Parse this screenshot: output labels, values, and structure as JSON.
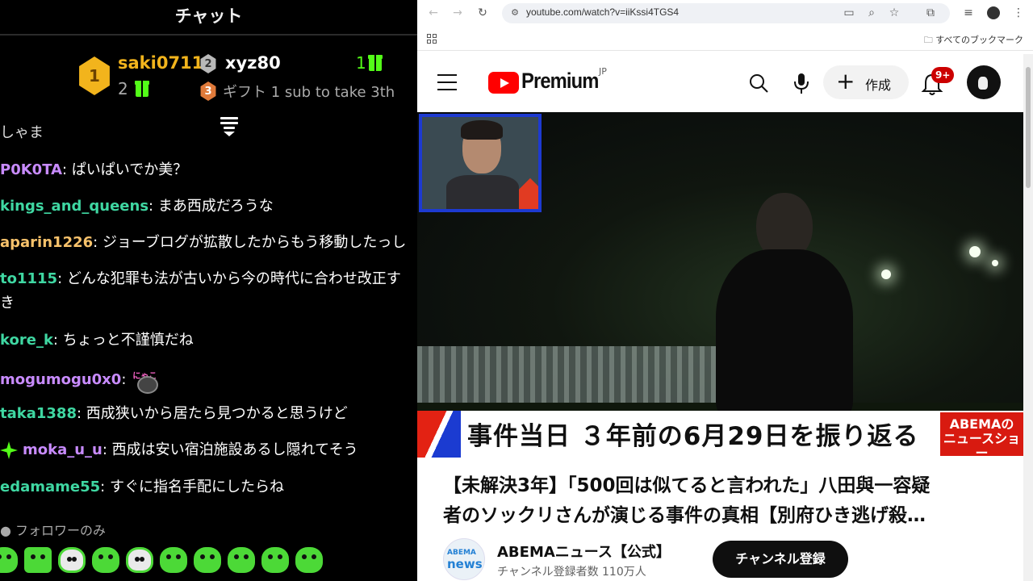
{
  "chat": {
    "title": "チャット",
    "leaderboard": {
      "first": {
        "rank": "1",
        "name": "saki0711",
        "count": "2"
      },
      "second": {
        "rank": "2",
        "name": "xyz80",
        "count": "1"
      },
      "third": {
        "rank": "3",
        "text": "ギフト 1 sub to take 3th"
      }
    },
    "cut_message": "しゃま",
    "messages": [
      {
        "user": "P0K0TA",
        "color": "#c88bff",
        "text": "ぱいぱいでか美？"
      },
      {
        "user": "kings_and_queens",
        "color": "#3fd7a2",
        "text": "まあ西成だろうな"
      },
      {
        "user": "aparin1226",
        "color": "#f7c26b",
        "text": "ジョーブログが拡散したからもう移動したっし"
      },
      {
        "user": "to1115",
        "color": "#3fd7a2",
        "text": "どんな犯罪も法が古いから今の時代に合わせ改正す",
        "text2": "き"
      },
      {
        "user": "kore_k",
        "color": "#3fd7a2",
        "text": "ちょっと不謹慎だね"
      },
      {
        "user": "mogumogu0x0",
        "color": "#c88bff",
        "text": "",
        "emote": "にゃこ"
      },
      {
        "user": "taka1388",
        "color": "#3fd7a2",
        "text": "西成狭いから居たら見つかると思うけど"
      },
      {
        "user": "moka_u_u",
        "color": "#c88bff",
        "text": "西成は安い宿泊施設あるし隠れてそう"
      },
      {
        "user": "edamame55",
        "color": "#3fd7a2",
        "text": "すぐに指名手配にしたらね"
      }
    ],
    "followers_only": "フォロワーのみ",
    "accent_color": "#53fc18"
  },
  "browser": {
    "url": "youtube.com/watch?v=iiKssi4TGS4",
    "bookmarks_label": "すべてのブックマーク"
  },
  "youtube": {
    "logo_text": "Premium",
    "region": "JP",
    "create_label": "作成",
    "notifications": "9+",
    "video_caption": "事件当日 ３年前の6月29日を振り返る",
    "caption_logo_line1": "ABEMAの",
    "caption_logo_line2": "ニュースショー",
    "title_line1": "【未解決3年】「500回は似てると言われた」八田與一容疑",
    "title_line2": "者のソックリさんが演じる事件の真相【別府ひき逃げ殺…",
    "channel_logo_line1": "ABEMA",
    "channel_logo_line2": "news/",
    "channel_name": "ABEMAニュース【公式】",
    "subscribers": "チャンネル登録者数 110万人",
    "subscribe_label": "チャンネル登録"
  }
}
